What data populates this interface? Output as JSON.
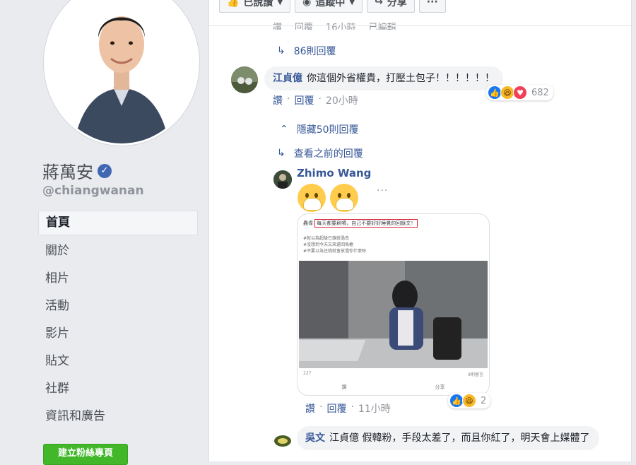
{
  "sidebar": {
    "page_name": "蔣萬安",
    "verified_glyph": "✓",
    "handle": "@chiangwanan",
    "nav": [
      {
        "label": "首頁",
        "active": true
      },
      {
        "label": "關於"
      },
      {
        "label": "相片"
      },
      {
        "label": "活動"
      },
      {
        "label": "影片"
      },
      {
        "label": "貼文"
      },
      {
        "label": "社群"
      },
      {
        "label": "資訊和廣告"
      }
    ],
    "create_button": "建立粉絲專頁"
  },
  "action_bar": {
    "liked": "已說讚",
    "following": "追蹤中",
    "share": "分享",
    "more": "···"
  },
  "clipped_row": {
    "like": "讚",
    "reply": "回覆",
    "time": "16小時",
    "edited": "已編輯"
  },
  "thread": {
    "replies_86": "86則回覆",
    "comment1": {
      "author": "江貞億",
      "text": "你這個外省權貴，打壓土包子！！！！！！",
      "like": "讚",
      "reply": "回覆",
      "time": "20小時",
      "reaction_count": "682",
      "reactions": [
        "like-icon",
        "haha-icon",
        "love-icon"
      ]
    },
    "hide_50": "隱藏50則回覆",
    "view_prev": "查看之前的回覆",
    "comment2": {
      "author": "Zhimo Wang",
      "more": "···",
      "card": {
        "header_prefix": "轟偉",
        "header_highlight": "每天都要刷噴，自己不要好好睡覺的回錄文！",
        "lines": [
          "#就以為超級已錄就過去",
          "#沒想到今天又來還回馬槍",
          "#不要以為住桃就會放過你什麼呀"
        ],
        "foot_left": "227",
        "foot_right": "9則留言",
        "act_like": "讚",
        "act_share": "分享"
      },
      "like": "讚",
      "reply": "回覆",
      "time": "11小時",
      "reaction_count": "2",
      "reactions": [
        "like-icon",
        "haha-icon"
      ]
    },
    "comment3": {
      "author": "吳文",
      "text": "江貞億 假韓粉，手段太差了，而且你紅了，明天會上媒體了"
    }
  },
  "colors": {
    "link": "#385898",
    "green_button": "#42b72a",
    "sidebar_bg": "#e9ebee"
  }
}
